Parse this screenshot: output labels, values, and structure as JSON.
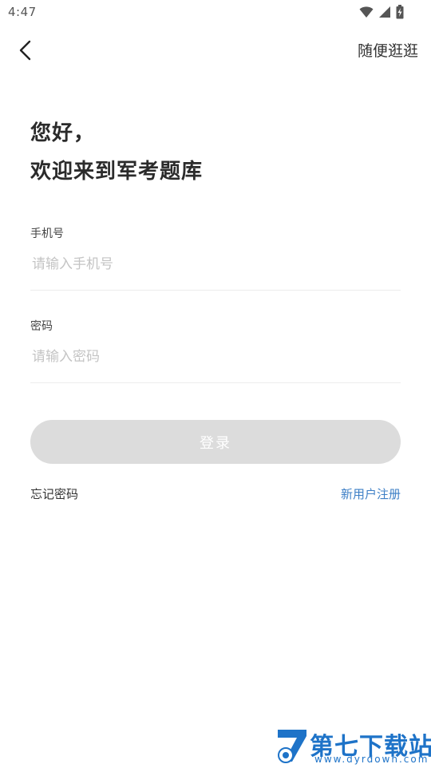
{
  "status_bar": {
    "time": "4:47",
    "icons": [
      "wifi-icon",
      "signal-icon",
      "battery-icon"
    ]
  },
  "header": {
    "back_icon": "chevron-left-icon",
    "browse_label": "随便逛逛"
  },
  "greeting": {
    "line1": "您好，",
    "line2": "欢迎来到军考题库"
  },
  "form": {
    "phone": {
      "label": "手机号",
      "value": "",
      "placeholder": "请输入手机号"
    },
    "password": {
      "label": "密码",
      "value": "",
      "placeholder": "请输入密码"
    },
    "login_label": "登录"
  },
  "links": {
    "forgot_password": "忘记密码",
    "register": "新用户注册"
  },
  "watermark": {
    "title": "第七下载站",
    "url": "www.dyrdown.com"
  },
  "colors": {
    "accent_link": "#3d7fc6",
    "button_disabled": "#dcdcdc",
    "placeholder": "#c4c4c4",
    "watermark": "#1e73c8"
  }
}
